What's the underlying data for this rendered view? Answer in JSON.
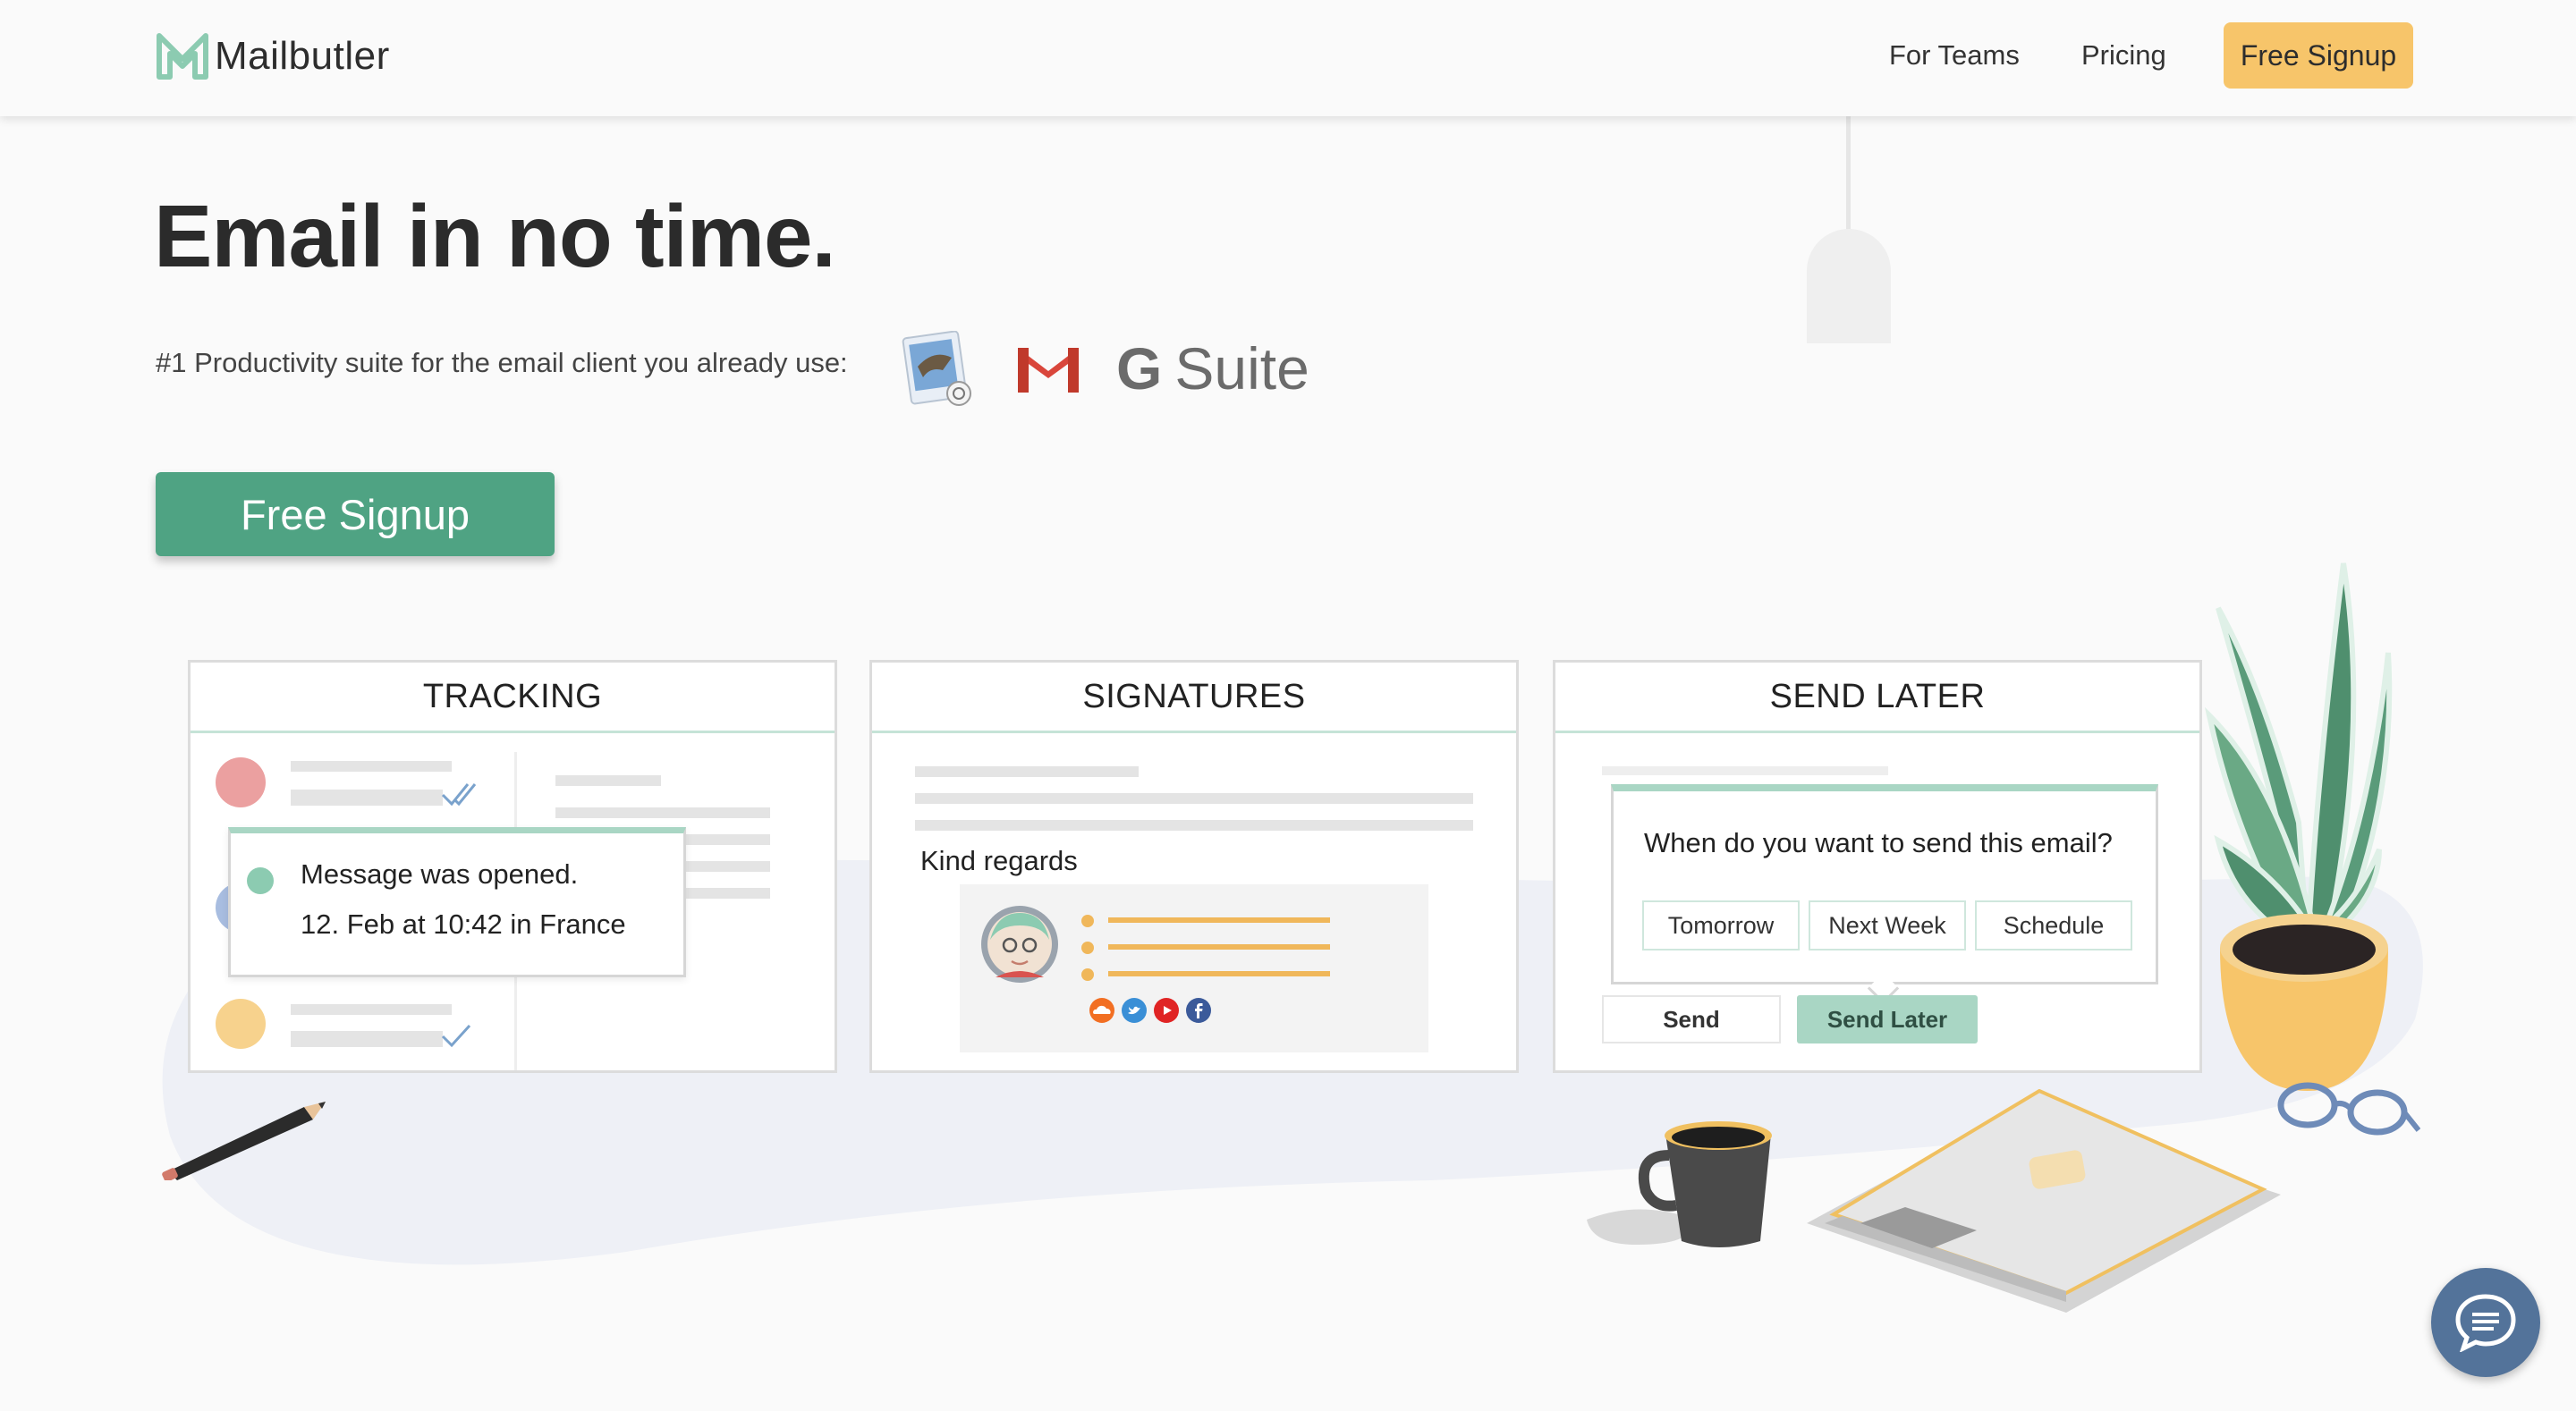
{
  "header": {
    "logo_text": "Mailbutler",
    "nav": {
      "teams": "For Teams",
      "pricing": "Pricing"
    },
    "signup_label": "Free Signup",
    "signup_color": "#f7c56a"
  },
  "hero": {
    "title": "Email in no time.",
    "subtitle": "#1 Productivity suite for the email client you already use:",
    "clients": {
      "apple_mail_icon": "apple-mail-icon",
      "gmail_icon": "gmail-icon",
      "gsuite_g": "G",
      "gsuite_word": "Suite"
    },
    "cta_label": "Free Signup",
    "cta_color": "#4fa383"
  },
  "cards": {
    "tracking": {
      "title": "TRACKING",
      "popup_line1": "Message was opened.",
      "popup_line2": "12. Feb at 10:42 in France"
    },
    "signatures": {
      "title": "SIGNATURES",
      "closing": "Kind regards",
      "social_icons": [
        "soundcloud-icon",
        "twitter-icon",
        "youtube-icon",
        "facebook-icon"
      ]
    },
    "send_later": {
      "title": "SEND LATER",
      "question": "When do you want to send this email?",
      "options": [
        "Tomorrow",
        "Next Week",
        "Schedule"
      ],
      "send_label": "Send",
      "send_later_label": "Send Later"
    }
  },
  "chat": {
    "icon": "chat-icon"
  }
}
